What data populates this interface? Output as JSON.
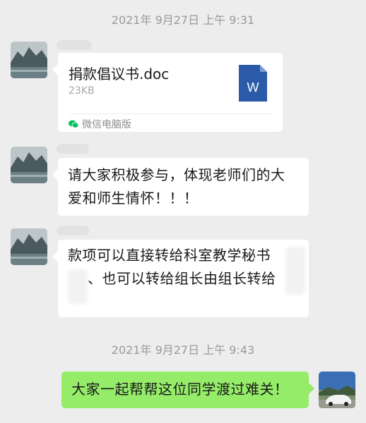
{
  "timestamps": [
    "2021年 9月27日 上午 9:31",
    "2021年 9月27日 上午 9:43"
  ],
  "messages": {
    "file": {
      "name": "捐款倡议书.doc",
      "size": "23KB",
      "icon_letter": "W",
      "source": "微信电脑版"
    },
    "text1": {
      "line1": "请大家积极参与，体现老师们的大",
      "line2": "爱和师生情怀！！！"
    },
    "text2": {
      "line1": "款项可以直接转给科室教学秘书",
      "line2": "、也可以转给组长由组长转给"
    },
    "self": {
      "text": "大家一起帮帮这位同学渡过难关！"
    }
  },
  "colors": {
    "background": "#ededed",
    "self_bubble": "#95ec69",
    "word_icon": "#2b5aa8",
    "wechat_green": "#07c160"
  }
}
